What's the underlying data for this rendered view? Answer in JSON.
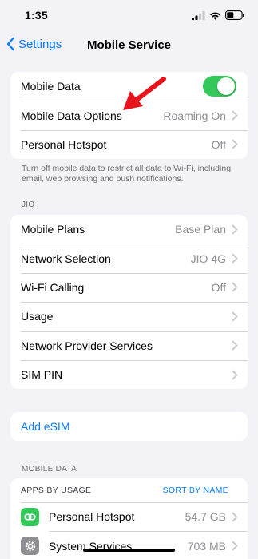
{
  "status": {
    "time": "1:35"
  },
  "nav": {
    "back_label": "Settings",
    "title": "Mobile Service"
  },
  "group1": {
    "mobile_data": {
      "label": "Mobile Data",
      "toggle_on": true
    },
    "options": {
      "label": "Mobile Data Options",
      "value": "Roaming On"
    },
    "hotspot": {
      "label": "Personal Hotspot",
      "value": "Off"
    }
  },
  "footnote": "Turn off mobile data to restrict all data to Wi-Fi, including email, web browsing and push notifications.",
  "carrier": {
    "header": "JIO",
    "rows": [
      {
        "label": "Mobile Plans",
        "value": "Base Plan"
      },
      {
        "label": "Network Selection",
        "value": "JIO 4G"
      },
      {
        "label": "Wi-Fi Calling",
        "value": "Off"
      },
      {
        "label": "Usage",
        "value": ""
      },
      {
        "label": "Network Provider Services",
        "value": ""
      },
      {
        "label": "SIM PIN",
        "value": ""
      }
    ]
  },
  "esim": {
    "label": "Add eSIM"
  },
  "mobile_data_section": {
    "header": "MOBILE DATA",
    "apps_by_usage": "APPS BY USAGE",
    "sort_label": "SORT BY NAME",
    "apps": [
      {
        "name": "Personal Hotspot",
        "usage": "54.7 GB",
        "icon": "link-icon",
        "color": "#34c759"
      },
      {
        "name": "System Services",
        "usage": "703 MB",
        "icon": "gear-icon",
        "color": "#8e8e93"
      }
    ]
  },
  "colors": {
    "accent": "#0a7aff",
    "toggle_on": "#34c759",
    "arrow": "#e8141b"
  }
}
